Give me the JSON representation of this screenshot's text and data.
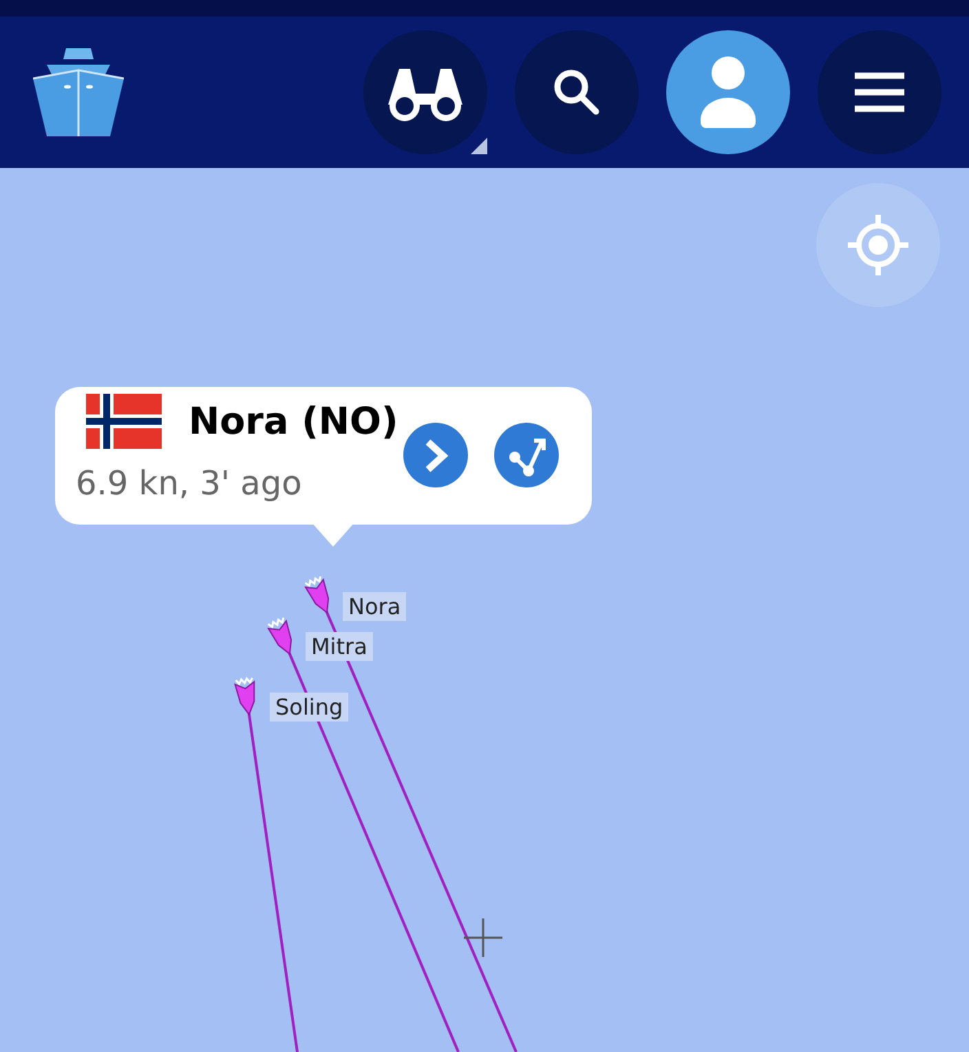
{
  "header_buttons": [
    {
      "kind": "binoculars",
      "selected": false
    },
    {
      "kind": "search",
      "selected": false
    },
    {
      "kind": "profile",
      "selected": true
    },
    {
      "kind": "menu",
      "selected": false
    }
  ],
  "popup": {
    "title": "Nora (NO)",
    "subtitle": "6.9 kn, 3' ago"
  },
  "vessels": [
    {
      "name": "Nora"
    },
    {
      "name": "Mitra"
    },
    {
      "name": "Soling"
    }
  ]
}
